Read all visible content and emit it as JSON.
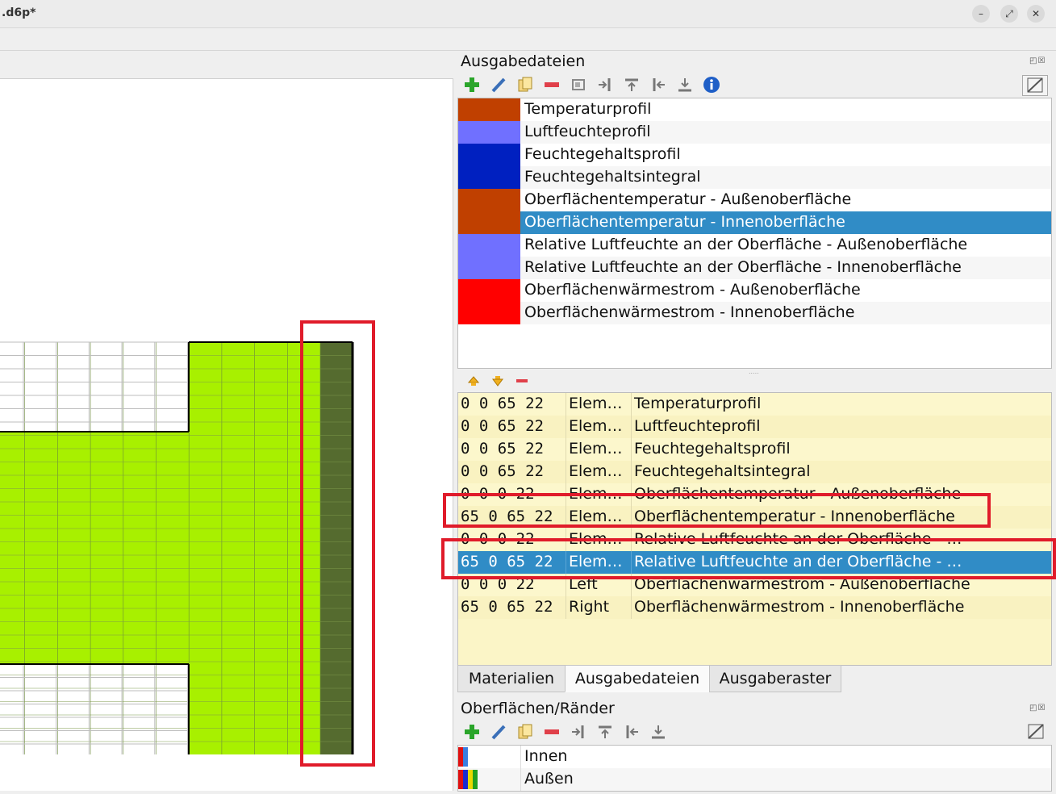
{
  "window": {
    "title": ".d6p*",
    "minimize_icon": "minimize-icon",
    "restore_icon": "restore-icon",
    "close_icon": "close-icon"
  },
  "output_files_dock": {
    "title": "Ausgabedateien",
    "toolbar_icons": [
      "add-icon",
      "edit-icon",
      "copy-icon",
      "remove-icon",
      "assign-icon",
      "assign-left-icon",
      "assign-top-icon",
      "assign-right-icon",
      "assign-bottom-icon",
      "info-icon"
    ],
    "items": [
      {
        "label": "Temperaturprofil",
        "color": "#c04000"
      },
      {
        "label": "Luftfeuchteprofil",
        "color": "#7070ff"
      },
      {
        "label": "Feuchtegehaltsprofil",
        "color": "#0020c0"
      },
      {
        "label": "Feuchtegehaltsintegral",
        "color": "#0020c0"
      },
      {
        "label": "Oberflächentemperatur - Außenoberfläche",
        "color": "#c04000"
      },
      {
        "label": "Oberflächentemperatur - Innenoberfläche",
        "color": "#c04000"
      },
      {
        "label": "Relative Luftfeuchte an der Oberfläche - Außenoberfläche",
        "color": "#7070ff"
      },
      {
        "label": "Relative Luftfeuchte an der Oberfläche - Innenoberfläche",
        "color": "#7070ff"
      },
      {
        "label": "Oberflächenwärmestrom - Außenoberfläche",
        "color": "#ff0000"
      },
      {
        "label": "Oberflächenwärmestrom - Innenoberfläche",
        "color": "#ff0000"
      }
    ],
    "selected_index": 5
  },
  "assignments_table": {
    "toolbar_icons": [
      "move-up-icon",
      "move-down-icon",
      "remove-icon"
    ],
    "rows": [
      {
        "coords": "0 0 65 22",
        "location": "Elem…",
        "output": "Temperaturprofil"
      },
      {
        "coords": "0 0 65 22",
        "location": "Elem…",
        "output": "Luftfeuchteprofil"
      },
      {
        "coords": "0 0 65 22",
        "location": "Elem…",
        "output": "Feuchtegehaltsprofil"
      },
      {
        "coords": "0 0 65 22",
        "location": "Elem…",
        "output": "Feuchtegehaltsintegral"
      },
      {
        "coords": "0 0 0 22",
        "location": "Elem…",
        "output": "Oberflächentemperatur - Außenoberfläche"
      },
      {
        "coords": "65 0 65 22",
        "location": "Elem…",
        "output": "Oberflächentemperatur - Innenoberfläche"
      },
      {
        "coords": "0 0 0 22",
        "location": "Elem…",
        "output": "Relative Luftfeuchte an der Oberfläche - …"
      },
      {
        "coords": "65 0 65 22",
        "location": "Elem…",
        "output": "Relative Luftfeuchte an der Oberfläche - …"
      },
      {
        "coords": "0 0 0 22",
        "location": "Left",
        "output": "Oberflächenwärmestrom - Außenoberfläche"
      },
      {
        "coords": "65 0 65 22",
        "location": "Right",
        "output": "Oberflächenwärmestrom - Innenoberfläche"
      }
    ],
    "selected_index": 7
  },
  "tabs": [
    {
      "label": "Materialien",
      "active": false
    },
    {
      "label": "Ausgabedateien",
      "active": true
    },
    {
      "label": "Ausgaberaster",
      "active": false
    }
  ],
  "surfaces_dock": {
    "title": "Oberflächen/Ränder",
    "items": [
      {
        "label": "Innen"
      },
      {
        "label": "Außen"
      }
    ]
  },
  "colors": {
    "material_green": "#a8f000",
    "material_dark": "#556b2f",
    "selection": "#308cc6",
    "highlight_red": "#e01b2a"
  }
}
